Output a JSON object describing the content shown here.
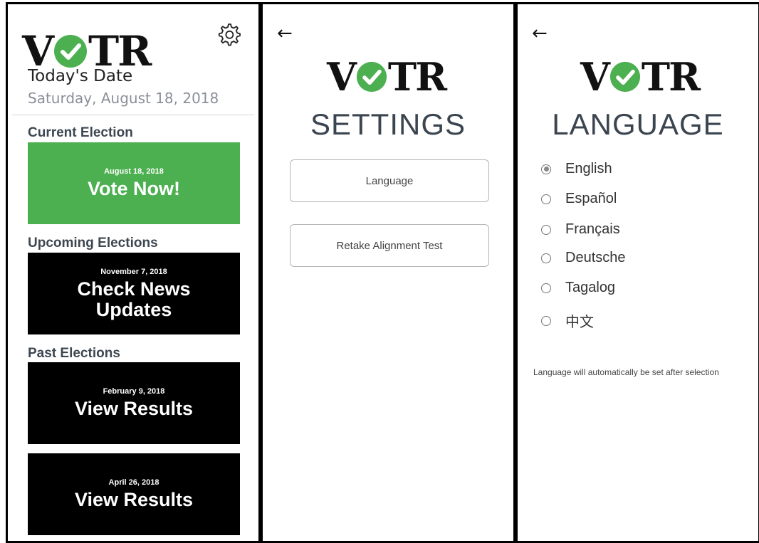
{
  "app": {
    "logo_text_left": "V",
    "logo_text_right": "TR",
    "brand_green": "#4caf50"
  },
  "home": {
    "today_label": "Today's Date",
    "today_date": "Saturday, August 18, 2018",
    "settings_icon": "gear-icon",
    "sections": {
      "current": "Current Election",
      "upcoming": "Upcoming Elections",
      "past": "Past Elections"
    },
    "current_election": {
      "date": "August 18, 2018",
      "action": "Vote Now!"
    },
    "upcoming_election": {
      "date": "November 7, 2018",
      "action": "Check News Updates"
    },
    "past_elections": [
      {
        "date": "February 9, 2018",
        "action": "View Results"
      },
      {
        "date": "April 26, 2018",
        "action": "View Results"
      }
    ]
  },
  "settings": {
    "back_icon": "back-arrow-icon",
    "title": "SETTINGS",
    "buttons": [
      "Language",
      "Retake Alignment Test"
    ]
  },
  "language": {
    "back_icon": "back-arrow-icon",
    "title": "LANGUAGE",
    "options": [
      "English",
      "Español",
      "Français",
      "Deutsche",
      "Tagalog",
      "中文"
    ],
    "selected": "English",
    "note": "Language will automatically be set after selection"
  }
}
